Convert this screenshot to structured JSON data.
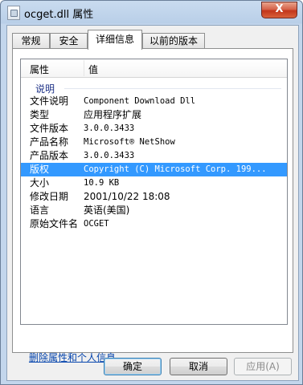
{
  "window": {
    "title": "ocget.dll 属性",
    "close_glyph": "X"
  },
  "tabs": [
    {
      "label": "常规"
    },
    {
      "label": "安全"
    },
    {
      "label": "详细信息"
    },
    {
      "label": "以前的版本"
    }
  ],
  "list": {
    "col_property": "属性",
    "col_value": "值",
    "group_label": "说明",
    "rows": [
      {
        "key": "文件说明",
        "value": "Component Download Dll"
      },
      {
        "key": "类型",
        "value": "应用程序扩展"
      },
      {
        "key": "文件版本",
        "value": "3.0.0.3433"
      },
      {
        "key": "产品名称",
        "value": "Microsoft® NetShow"
      },
      {
        "key": "产品版本",
        "value": "3.0.0.3433"
      },
      {
        "key": "版权",
        "value": "Copyright (C) Microsoft Corp. 199..."
      },
      {
        "key": "大小",
        "value": "10.9 KB"
      },
      {
        "key": "修改日期",
        "value": "2001/10/22 18:08"
      },
      {
        "key": "语言",
        "value": "英语(美国)"
      },
      {
        "key": "原始文件名",
        "value": "OCGET"
      }
    ]
  },
  "remove_link": "删除属性和个人信息",
  "buttons": {
    "ok": "确定",
    "cancel": "取消",
    "apply": "应用(A)"
  },
  "colors": {
    "selection": "#3399ff",
    "group_text": "#1e3287",
    "link": "#0645ad"
  }
}
